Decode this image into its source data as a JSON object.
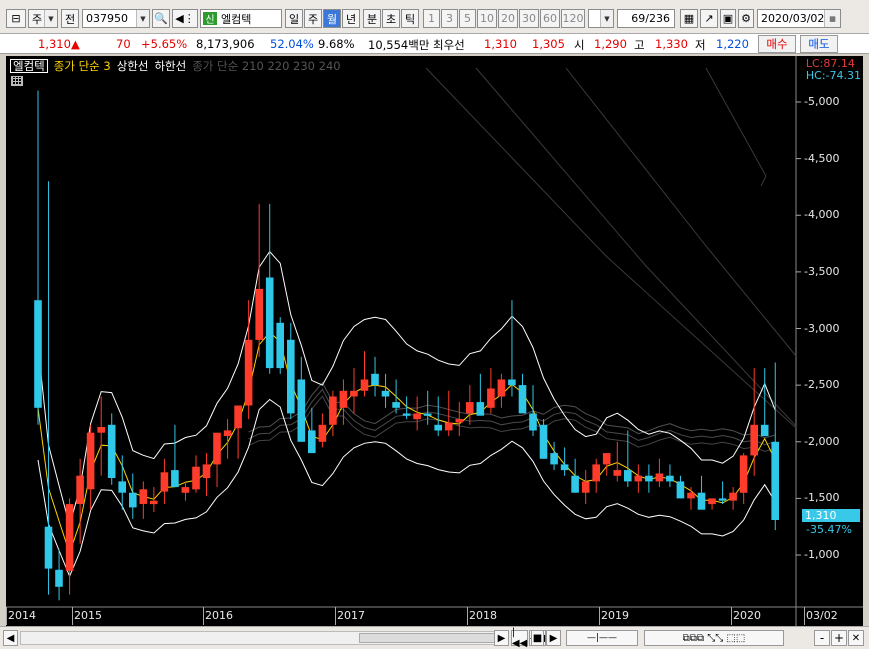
{
  "toolbar": {
    "market": "주",
    "prev_label": "전",
    "code": "037950",
    "stock_name": "엘컴텍",
    "new_badge": "신",
    "period_tabs": [
      "일",
      "주",
      "월",
      "년"
    ],
    "active_period": "월",
    "intraday_tabs": [
      "분",
      "초",
      "틱"
    ],
    "intervals": [
      "1",
      "3",
      "5",
      "10",
      "20",
      "30",
      "60",
      "120"
    ],
    "count": "69/236",
    "date": "2020/03/02"
  },
  "quote": {
    "price": "1,310",
    "change_arrow": "▲",
    "change": "70",
    "change_pct": "+5.65%",
    "volume": "8,173,906",
    "volume_ratio": "52.04%",
    "turnover": "9.68%",
    "amount": "10,554백만",
    "best_ask_label": "최우선",
    "best_ask": "1,310",
    "best_bid": "1,305",
    "open_label": "시",
    "open": "1,290",
    "high_label": "고",
    "high": "1,330",
    "low_label": "저",
    "low": "1,220",
    "buy_label": "매수",
    "sell_label": "매도"
  },
  "legend": {
    "name": "엘컴텍",
    "ma3": "종가 단순 3",
    "upper": "상한선",
    "lower": "하한선",
    "ma_long": "종가 단순 210 220 230 240"
  },
  "corner": {
    "lc": "LC:87.14",
    "hc": "HC:-74.31"
  },
  "price_tag": {
    "value": "1,310",
    "pct": "-35.47%"
  },
  "colors": {
    "up": "#ff3c2c",
    "down": "#30c8e8",
    "ma3": "#ffd400",
    "band": "#ffffff",
    "background": "#000000"
  },
  "chart_data": {
    "type": "candlestick",
    "y_ticks": [
      "5,000",
      "4,500",
      "4,000",
      "3,500",
      "3,000",
      "2,500",
      "2,000",
      "1,500",
      "1,000"
    ],
    "ylim": [
      550,
      5300
    ],
    "x_labels": [
      "2014",
      "2015",
      "2016",
      "2017",
      "2018",
      "2019",
      "2020",
      "03/02"
    ],
    "candles": [
      [
        3250,
        5100,
        2150,
        2300
      ],
      [
        1250,
        4300,
        650,
        880
      ],
      [
        870,
        1050,
        600,
        720
      ],
      [
        860,
        1500,
        650,
        1450
      ],
      [
        1450,
        1850,
        1100,
        1700
      ],
      [
        1580,
        2150,
        1400,
        2080
      ],
      [
        2080,
        2400,
        1700,
        2130
      ],
      [
        2150,
        2250,
        1620,
        1680
      ],
      [
        1650,
        1880,
        1400,
        1550
      ],
      [
        1550,
        1720,
        1320,
        1420
      ],
      [
        1450,
        1650,
        1320,
        1580
      ],
      [
        1450,
        1600,
        1380,
        1480
      ],
      [
        1560,
        1850,
        1450,
        1730
      ],
      [
        1750,
        2150,
        1650,
        1600
      ],
      [
        1550,
        1650,
        1480,
        1600
      ],
      [
        1580,
        1880,
        1550,
        1780
      ],
      [
        1680,
        1900,
        1520,
        1800
      ],
      [
        1800,
        2050,
        1600,
        2080
      ],
      [
        2050,
        2200,
        1850,
        2100
      ],
      [
        2120,
        2200,
        1850,
        2320
      ],
      [
        2320,
        3250,
        2200,
        2900
      ],
      [
        2900,
        4100,
        2750,
        3350
      ],
      [
        3450,
        4100,
        2600,
        2650
      ],
      [
        3050,
        3100,
        2600,
        2650
      ],
      [
        2900,
        3050,
        2200,
        2250
      ],
      [
        2550,
        2750,
        2000,
        2000
      ],
      [
        2100,
        2300,
        1950,
        1900
      ],
      [
        2000,
        2250,
        1950,
        2150
      ],
      [
        2150,
        2450,
        2050,
        2400
      ],
      [
        2300,
        2550,
        2150,
        2450
      ],
      [
        2400,
        2650,
        2250,
        2450
      ],
      [
        2450,
        2800,
        2400,
        2550
      ],
      [
        2600,
        2750,
        2400,
        2500
      ],
      [
        2450,
        2600,
        2300,
        2400
      ],
      [
        2350,
        2550,
        2250,
        2300
      ],
      [
        2250,
        2400,
        2200,
        2230
      ],
      [
        2200,
        2400,
        2100,
        2250
      ],
      [
        2250,
        2450,
        2150,
        2230
      ],
      [
        2150,
        2400,
        2050,
        2100
      ],
      [
        2100,
        2450,
        2050,
        2170
      ],
      [
        2170,
        2350,
        2050,
        2200
      ],
      [
        2250,
        2500,
        2150,
        2350
      ],
      [
        2350,
        2600,
        2250,
        2230
      ],
      [
        2300,
        2650,
        2250,
        2470
      ],
      [
        2400,
        2600,
        2300,
        2550
      ],
      [
        2550,
        3250,
        2400,
        2500
      ],
      [
        2500,
        2600,
        2350,
        2250
      ],
      [
        2250,
        2500,
        2050,
        2100
      ],
      [
        2150,
        2200,
        1950,
        1850
      ],
      [
        1900,
        2000,
        1750,
        1800
      ],
      [
        1800,
        1950,
        1700,
        1750
      ],
      [
        1700,
        1850,
        1550,
        1550
      ],
      [
        1550,
        1750,
        1450,
        1650
      ],
      [
        1650,
        1850,
        1550,
        1800
      ],
      [
        1800,
        1900,
        1700,
        1900
      ],
      [
        1700,
        2000,
        1650,
        1750
      ],
      [
        1750,
        2100,
        1600,
        1650
      ],
      [
        1650,
        1800,
        1550,
        1700
      ],
      [
        1700,
        1800,
        1550,
        1650
      ],
      [
        1650,
        1850,
        1600,
        1720
      ],
      [
        1700,
        1800,
        1600,
        1650
      ],
      [
        1650,
        1700,
        1500,
        1500
      ],
      [
        1500,
        1600,
        1400,
        1550
      ],
      [
        1550,
        1700,
        1450,
        1400
      ],
      [
        1450,
        1500,
        1400,
        1500
      ],
      [
        1500,
        1650,
        1450,
        1480
      ],
      [
        1480,
        1600,
        1400,
        1550
      ],
      [
        1550,
        1900,
        1450,
        1880
      ],
      [
        1880,
        2650,
        1700,
        2150
      ],
      [
        2150,
        2650,
        2050,
        2050
      ],
      [
        2000,
        2700,
        1220,
        1310
      ]
    ]
  },
  "statusbar": {
    "buttons": [
      "◀",
      "▶",
      "|◀◀",
      "◀◀",
      "■",
      "▶",
      "▶▶|",
      "-",
      "+"
    ]
  }
}
